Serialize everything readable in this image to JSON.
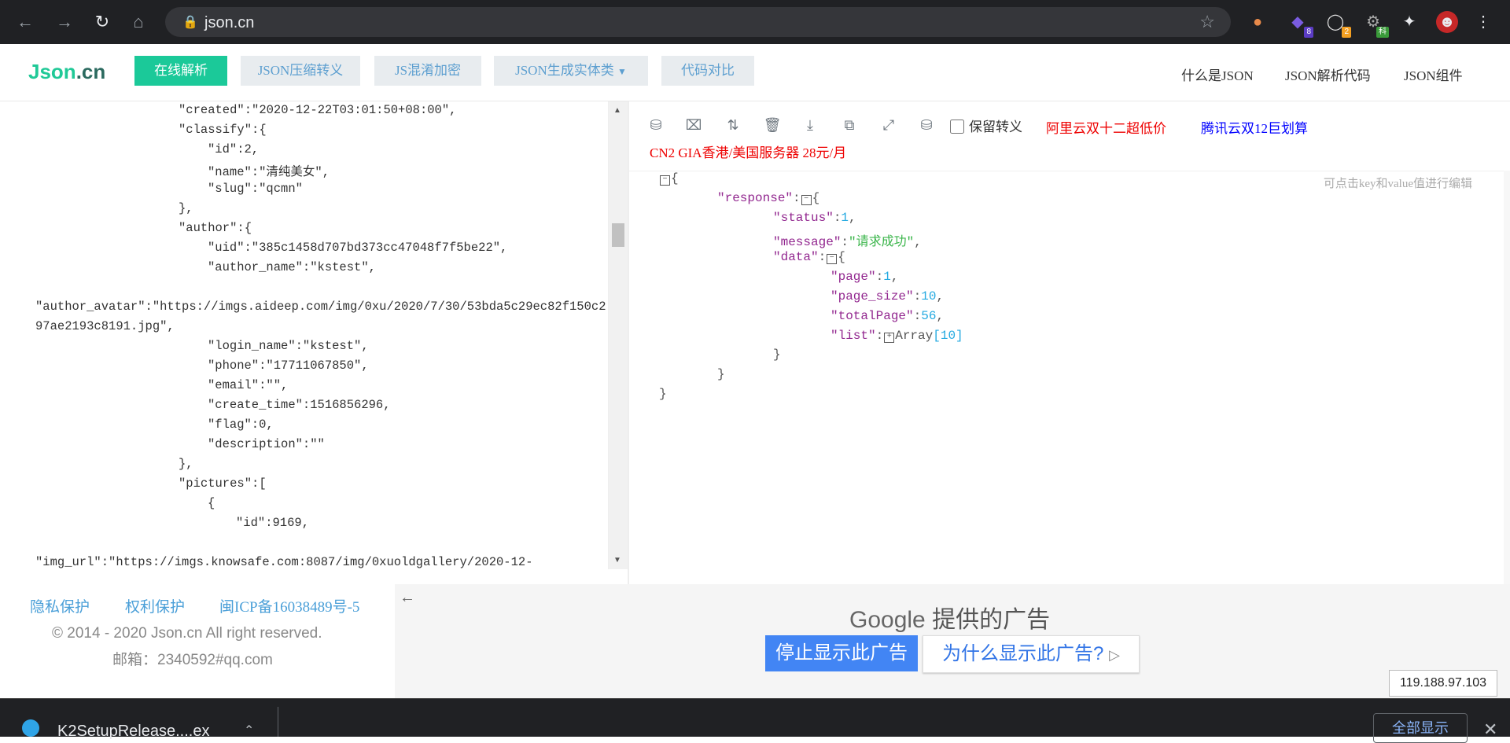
{
  "browser": {
    "url": "json.cn",
    "extensions": [
      {
        "name": "cookie-icon"
      },
      {
        "name": "hex-extension-icon",
        "badge": "8",
        "badge_color": "#5b3cc4"
      },
      {
        "name": "magnifier-extension-icon",
        "badge": "2",
        "badge_color": "#f4a022"
      },
      {
        "name": "gear-extension-icon",
        "badge": "科",
        "badge_color": "#3a9b3a"
      },
      {
        "name": "puzzle-icon"
      },
      {
        "name": "profile-avatar-icon"
      }
    ]
  },
  "header": {
    "logo_main": "Json",
    "logo_suffix": ".cn",
    "buttons": [
      "在线解析",
      "JSON压缩转义",
      "JS混淆加密",
      "JSON生成实体类",
      "代码对比"
    ],
    "links": [
      "什么是JSON",
      "JSON解析代码",
      "JSON组件"
    ]
  },
  "left_editor": {
    "lines": [
      "\"created\":\"2020-12-22T03:01:50+08:00\",",
      "\"classify\":{",
      "\"id\":2,",
      "\"name\":\"清纯美女\",",
      "\"slug\":\"qcmn\"",
      "},",
      "\"author\":{",
      "\"uid\":\"385c1458d707bd373cc47048f7f5be22\",",
      "\"author_name\":\"kstest\",",
      "",
      "\"author_avatar\":\"https://imgs.aideep.com/img/0xu/2020/7/30/53bda5c29ec82f150c2",
      "97ae2193c8191.jpg\",",
      "\"login_name\":\"kstest\",",
      "\"phone\":\"17711067850\",",
      "\"email\":\"\",",
      "\"create_time\":1516856296,",
      "\"flag\":0,",
      "\"description\":\"\"",
      "},",
      "\"pictures\":[",
      "{",
      "\"id\":9169,",
      "",
      "\"img_url\":\"https://imgs.knowsafe.com:8087/img/0xuoldgallery/2020-12-"
    ]
  },
  "right_panel": {
    "keep_escape_label": "保留转义",
    "ad_aliyun": "阿里云双十二超低价",
    "ad_tencent": "腾讯云双12巨划算",
    "ad_cn2": "CN2 GIA香港/美国服务器 28元/月",
    "hint": "可点击key和value值进行编辑",
    "json": {
      "response_key": "\"response\"",
      "status_key": "\"status\"",
      "status_val": "1",
      "message_key": "\"message\"",
      "message_val": "\"请求成功\"",
      "data_key": "\"data\"",
      "page_key": "\"page\"",
      "page_val": "1",
      "page_size_key": "\"page_size\"",
      "page_size_val": "10",
      "total_key": "\"totalPage\"",
      "total_val": "56",
      "list_key": "\"list\"",
      "list_type": "Array",
      "list_count": "[10]"
    }
  },
  "footer": {
    "links": [
      "隐私保护",
      "权利保护",
      "闽ICP备16038489号-5"
    ],
    "copyright": "© 2014 - 2020 Json.cn All right reserved.",
    "email": "邮箱：2340592#qq.com"
  },
  "ad": {
    "google_word": "Google",
    "provided": "提供的广告",
    "stop_label": "停止显示此广告",
    "why_label": "为什么显示此广告?",
    "ip": "119.188.97.103"
  },
  "download_bar": {
    "file_name": "K2SetupRelease....ex",
    "show_all": "全部显示"
  }
}
